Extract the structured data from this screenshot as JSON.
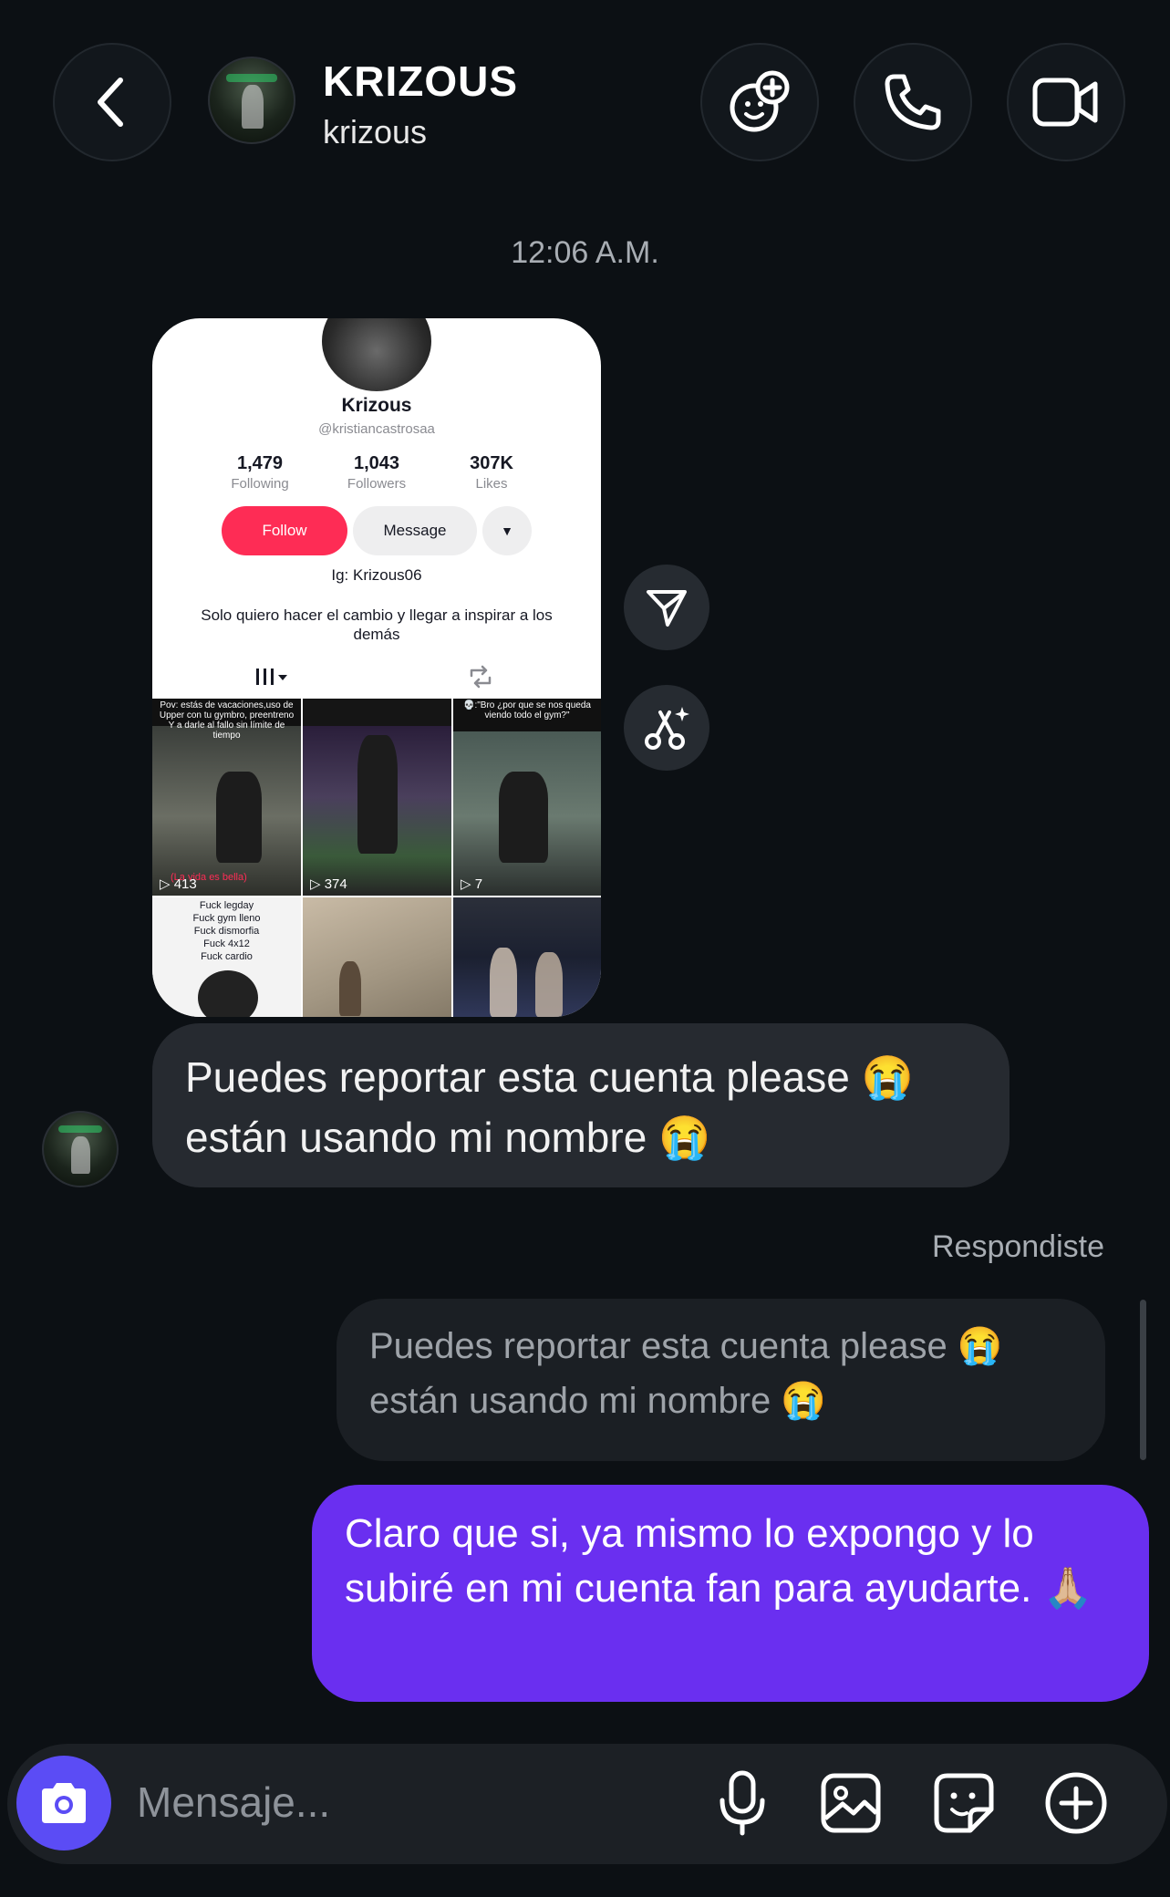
{
  "header": {
    "title": "KRIZOUS",
    "subtitle": "krizous",
    "icons": [
      "back-icon",
      "effects-icon",
      "phone-icon",
      "video-icon"
    ]
  },
  "timestamp": "12:06 A.M.",
  "shared_profile": {
    "name": "Krizous",
    "handle": "@kristiancastrosaa",
    "stats": [
      {
        "value": "1,479",
        "label": "Following"
      },
      {
        "value": "1,043",
        "label": "Followers"
      },
      {
        "value": "307K",
        "label": "Likes"
      }
    ],
    "follow_label": "Follow",
    "message_label": "Message",
    "ig_line": "Ig: Krizous06",
    "bio": "Solo quiero hacer el cambio y llegar a inspirar a los demás",
    "videos": [
      {
        "caption": "Pov: estás de vacaciones,uso de Upper con tu gymbro, preentreno Y a darle al fallo sin límite de tiempo",
        "views": "413",
        "overlay": "(La vida es bella)"
      },
      {
        "caption": "",
        "views": "374",
        "overlay": ""
      },
      {
        "caption": "💀:\"Bro ¿por que se nos queda viendo todo el gym?\"",
        "views": "7",
        "overlay": ""
      },
      {
        "caption": "Fuck legday\nFuck gym lleno\nFuck dismorfia\nFuck 4x12\nFuck cardio",
        "views": "",
        "overlay": ""
      },
      {
        "caption": "",
        "views": "",
        "overlay": ""
      },
      {
        "caption": "",
        "views": "",
        "overlay": ""
      }
    ]
  },
  "messages": {
    "incoming": "Puedes reportar esta cuenta please 😭 están usando mi nombre 😭",
    "replied_label": "Respondiste",
    "quoted": "Puedes reportar esta cuenta please 😭 están usando mi nombre 😭",
    "outgoing": "Claro que si, ya mismo lo expongo y lo subiré en mi cuenta fan para ayudarte. 🙏🏼"
  },
  "composer": {
    "placeholder": "Mensaje...",
    "icons": [
      "camera-icon",
      "microphone-icon",
      "gallery-icon",
      "sticker-icon",
      "plus-icon"
    ]
  },
  "colors": {
    "background": "#0c1014",
    "outgoing_bubble": "#6a2ff0",
    "incoming_bubble": "#262a30",
    "camera_button": "#5b4cf5",
    "tiktok_follow": "#fe2c55"
  }
}
